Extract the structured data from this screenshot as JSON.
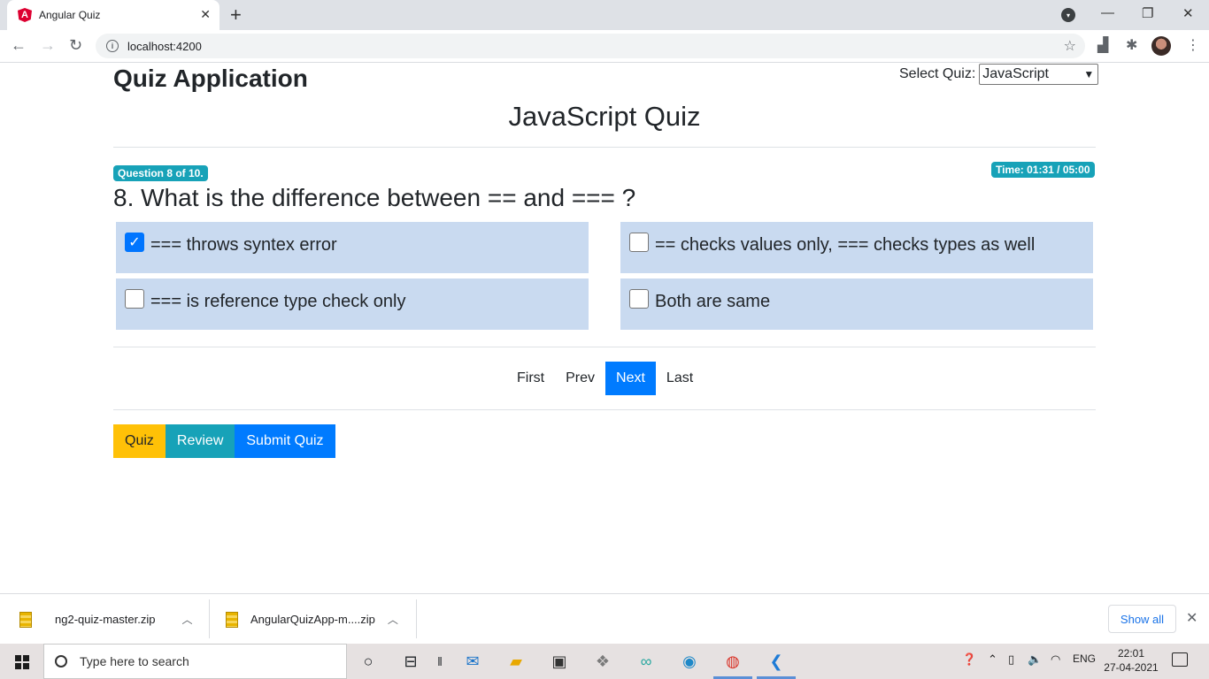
{
  "browser": {
    "tab_title": "Angular Quiz",
    "tab_logo": "A",
    "url": "localhost:4200"
  },
  "app": {
    "title": "Quiz Application",
    "select_label": "Select Quiz:",
    "select_value": "JavaScript",
    "quiz_name": "JavaScript Quiz"
  },
  "question": {
    "progress_badge": "Question 8 of 10.",
    "timer_badge": "Time: 01:31 / 05:00",
    "text": "8. What is the difference between == and === ?",
    "options": [
      {
        "label": "=== throws syntex error",
        "checked": true
      },
      {
        "label": "== checks values only, === checks types as well",
        "checked": false
      },
      {
        "label": "=== is reference type check only",
        "checked": false
      },
      {
        "label": "Both are same",
        "checked": false
      }
    ]
  },
  "pager": {
    "first": "First",
    "prev": "Prev",
    "next": "Next",
    "last": "Last"
  },
  "actions": {
    "quiz": "Quiz",
    "review": "Review",
    "submit": "Submit Quiz"
  },
  "downloads": {
    "items": [
      {
        "name": "ng2-quiz-master.zip"
      },
      {
        "name": "AngularQuizApp-m....zip"
      }
    ],
    "show_all": "Show all"
  },
  "taskbar": {
    "search_placeholder": "Type here to search",
    "language": "ENG",
    "time": "22:01",
    "date": "27-04-2021"
  },
  "colors": {
    "primary": "#007bff",
    "warning": "#ffc107",
    "info": "#17a2b8",
    "option_bg": "#c9daf0"
  }
}
